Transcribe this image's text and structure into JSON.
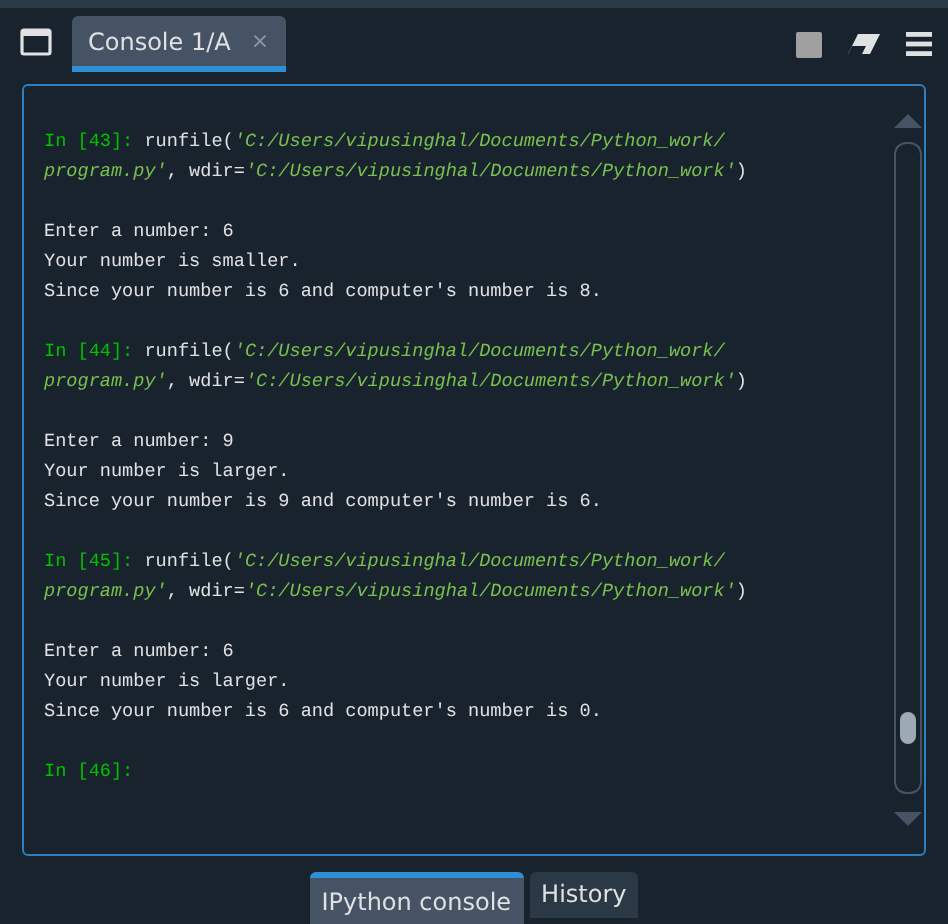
{
  "tabs": [
    {
      "label": "Console 1/A",
      "close": "×",
      "selected": true
    }
  ],
  "console": [
    {
      "kind": "input",
      "lines": [
        [
          {
            "kind": "prompt",
            "text": "In [43]:"
          },
          {
            "kind": "code",
            "text": " runfile("
          },
          {
            "kind": "string",
            "text": "'C:/Users/vipusinghal/Documents/Python_work/"
          }
        ],
        [
          {
            "kind": "string",
            "text": "program.py'"
          },
          {
            "kind": "code",
            "text": ", wdir="
          },
          {
            "kind": "string",
            "text": "'C:/Users/vipusinghal/Documents/Python_work'"
          },
          {
            "kind": "code",
            "text": ")"
          }
        ]
      ]
    },
    {
      "kind": "output",
      "lines": [
        "Enter a number: 6",
        "Your number is smaller.",
        "Since your number is 6 and computer's number is 8."
      ]
    },
    {
      "kind": "input",
      "lines": [
        [
          {
            "kind": "prompt",
            "text": "In [44]:"
          },
          {
            "kind": "code",
            "text": " runfile("
          },
          {
            "kind": "string",
            "text": "'C:/Users/vipusinghal/Documents/Python_work/"
          }
        ],
        [
          {
            "kind": "string",
            "text": "program.py'"
          },
          {
            "kind": "code",
            "text": ", wdir="
          },
          {
            "kind": "string",
            "text": "'C:/Users/vipusinghal/Documents/Python_work'"
          },
          {
            "kind": "code",
            "text": ")"
          }
        ]
      ]
    },
    {
      "kind": "output",
      "lines": [
        "Enter a number: 9",
        "Your number is larger.",
        "Since your number is 9 and computer's number is 6."
      ]
    },
    {
      "kind": "input",
      "lines": [
        [
          {
            "kind": "prompt",
            "text": "In [45]:"
          },
          {
            "kind": "code",
            "text": " runfile("
          },
          {
            "kind": "string",
            "text": "'C:/Users/vipusinghal/Documents/Python_work/"
          }
        ],
        [
          {
            "kind": "string",
            "text": "program.py'"
          },
          {
            "kind": "code",
            "text": ", wdir="
          },
          {
            "kind": "string",
            "text": "'C:/Users/vipusinghal/Documents/Python_work'"
          },
          {
            "kind": "code",
            "text": ")"
          }
        ]
      ]
    },
    {
      "kind": "output",
      "lines": [
        "Enter a number: 6",
        "Your number is larger.",
        "Since your number is 6 and computer's number is 0."
      ]
    },
    {
      "kind": "input",
      "lines": [
        [
          {
            "kind": "prompt",
            "text": "In [46]:"
          }
        ]
      ]
    }
  ],
  "bottom_tabs": [
    {
      "label": "IPython console",
      "selected": true
    },
    {
      "label": "History",
      "selected": false
    }
  ]
}
